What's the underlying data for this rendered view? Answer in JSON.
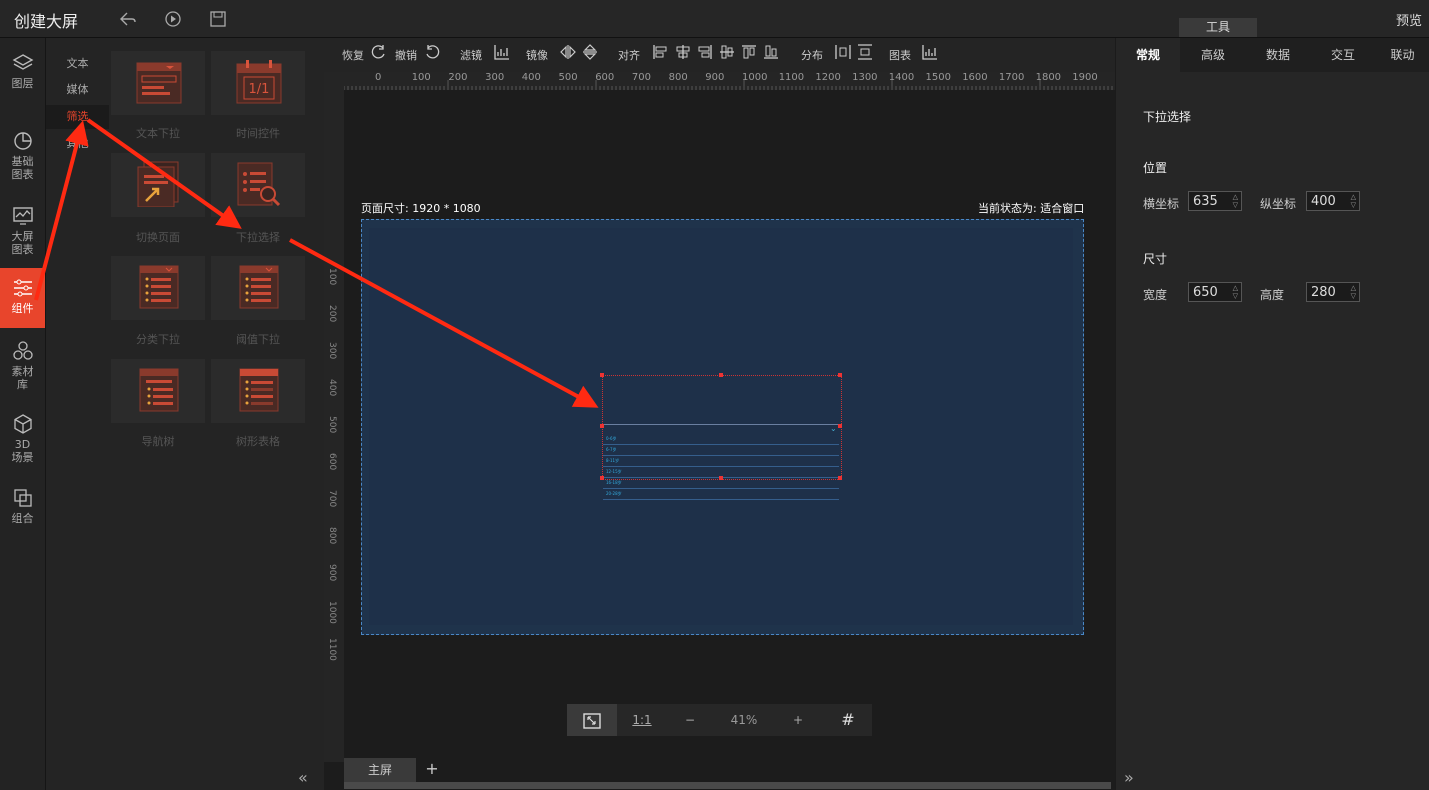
{
  "app": {
    "title": "创建大屏",
    "tools_tab": "工具",
    "preview": "预览"
  },
  "leftnav": [
    {
      "label1": "图层",
      "label2": "",
      "label3": "",
      "icon": "layers-icon"
    },
    {
      "label1": "基础",
      "label2": "图表",
      "label3": "",
      "icon": "pie-chart-icon"
    },
    {
      "label1": "大屏",
      "label2": "图表",
      "label3": "",
      "icon": "monitor-chart-icon"
    },
    {
      "label1": "组件",
      "label2": "",
      "label3": "",
      "icon": "sliders-icon"
    },
    {
      "label1": "素材",
      "label2": "库",
      "label3": "",
      "icon": "materials-icon"
    },
    {
      "label1": "3D",
      "label2": "场景",
      "label3": "",
      "icon": "cube-icon"
    },
    {
      "label1": "组合",
      "label2": "",
      "label3": "",
      "icon": "group-icon"
    }
  ],
  "categories": [
    "文本",
    "媒体",
    "筛选",
    "其他"
  ],
  "tiles": [
    "文本下拉",
    "时间控件",
    "切换页面",
    "下拉选择",
    "分类下拉",
    "阈值下拉",
    "导航树",
    "树形表格"
  ],
  "tile_icon_text": "1/1",
  "toolbar": {
    "redo": "恢复",
    "undo": "撤销",
    "filter": "滤镜",
    "mirror": "镜像",
    "align": "对齐",
    "distribute": "分布",
    "chart": "图表"
  },
  "ruler_ticks": [
    "0",
    "100",
    "200",
    "300",
    "400",
    "500",
    "600",
    "700",
    "800",
    "900",
    "1000",
    "1100",
    "1200",
    "1300",
    "1400",
    "1500",
    "1600",
    "1700",
    "1800",
    "1900"
  ],
  "ruler_left_ticks": [
    "100",
    "200",
    "300",
    "400",
    "500",
    "600",
    "700",
    "800",
    "900",
    "1000",
    "1100"
  ],
  "canvas": {
    "page_size": "页面尺寸: 1920 * 1080",
    "current_state": "当前状态为: 适合窗口"
  },
  "dropdown_rows": [
    "0-6岁",
    "6-7岁",
    "8-11岁",
    "12-15岁",
    "16-18岁",
    "20-28岁"
  ],
  "zoom": {
    "fit": "⛶",
    "one_to_one": "1:1",
    "minus": "−",
    "level": "41%",
    "plus": "+",
    "grid": "#"
  },
  "bottom_tabs": {
    "main": "主屏",
    "add": "+"
  },
  "right": {
    "tabs": [
      "常规",
      "高级",
      "数据",
      "交互",
      "联动"
    ],
    "title": "下拉选择",
    "position": {
      "heading": "位置",
      "x_label": "横坐标",
      "x": "635",
      "y_label": "纵坐标",
      "y": "400"
    },
    "size": {
      "heading": "尺寸",
      "w_label": "宽度",
      "w": "650",
      "h_label": "高度",
      "h": "280"
    }
  },
  "colors": {
    "accent": "#e8452c",
    "canvas": "#1f334b",
    "arrow": "#ff2a12"
  }
}
